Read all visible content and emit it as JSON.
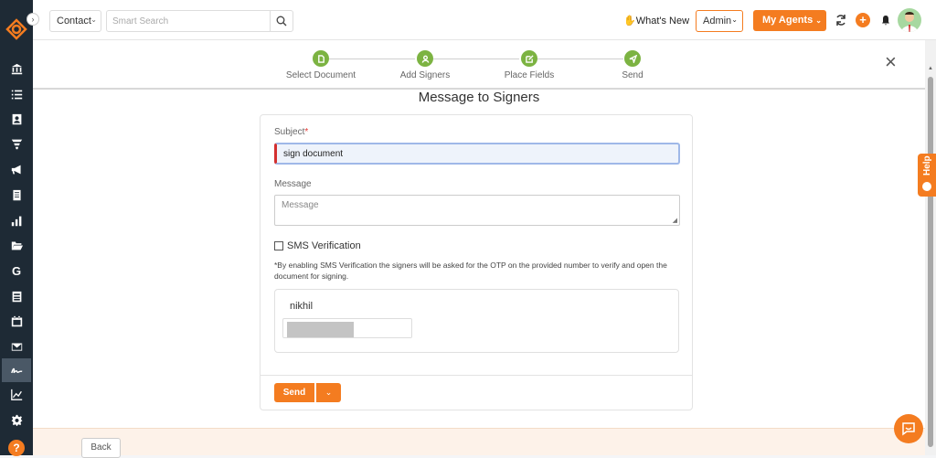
{
  "topbar": {
    "contact_label": "Contact",
    "search_placeholder": "Smart Search",
    "whats_new": "What's New",
    "admin_label": "Admin",
    "agents_label": "My Agents"
  },
  "steps": [
    {
      "label": "Select Document"
    },
    {
      "label": "Add Signers"
    },
    {
      "label": "Place Fields"
    },
    {
      "label": "Send"
    }
  ],
  "form": {
    "title": "Message to Signers",
    "subject_label": "Subject",
    "subject_required": "*",
    "subject_value": "sign document",
    "message_label": "Message",
    "message_placeholder": "Message",
    "sms_label": "SMS Verification",
    "sms_note": "*By enabling SMS Verification the signers will be asked for the OTP on the provided number to verify and open the document for signing.",
    "signer_name": "nikhil",
    "send_label": "Send"
  },
  "footer": {
    "back_label": "Back"
  },
  "help_tab": "Help",
  "colors": {
    "accent": "#f47c20",
    "step_green": "#7cb342",
    "sidebar": "#1e2a35"
  }
}
